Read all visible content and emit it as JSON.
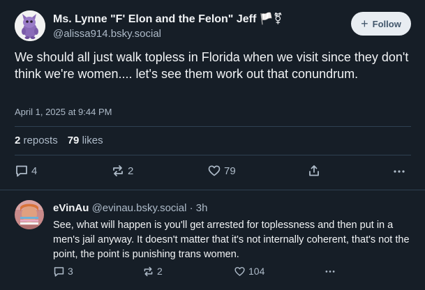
{
  "post": {
    "author_name": "Ms. Lynne \"F' Elon and the Felon\" Jeff 🏳️⚧",
    "author_handle": "@alissa914.bsky.social",
    "follow_label": "Follow",
    "text": "We should all just walk topless in Florida when we visit since they don't think we're women.... let's see them work out that conundrum.",
    "timestamp": "April 1, 2025 at 9:44 PM",
    "reposts_count": "2",
    "reposts_label": "reposts",
    "likes_count": "79",
    "likes_label": "likes",
    "actions": {
      "replies": "4",
      "reposts": "2",
      "likes": "79"
    }
  },
  "reply": {
    "author_name": "eVinAu",
    "author_handle": "@evinau.bsky.social",
    "separator": "·",
    "age": "3h",
    "text": "See, what will happen is you'll get arrested for toplessness and then put in a men's jail anyway. It doesn't matter that it's not internally coherent, that's not the point, the point is punishing trans women.",
    "actions": {
      "replies": "3",
      "reposts": "2",
      "likes": "104"
    }
  },
  "colors": {
    "background": "#161e27",
    "text_primary": "#f1f3f5",
    "text_secondary": "#aebbc9",
    "divider": "#2e4052",
    "follow_bg": "#e8edf2"
  },
  "icons": [
    "avatar-purple-creature",
    "plus-icon",
    "comment-icon",
    "repost-icon",
    "heart-icon",
    "share-icon",
    "more-icon"
  ]
}
